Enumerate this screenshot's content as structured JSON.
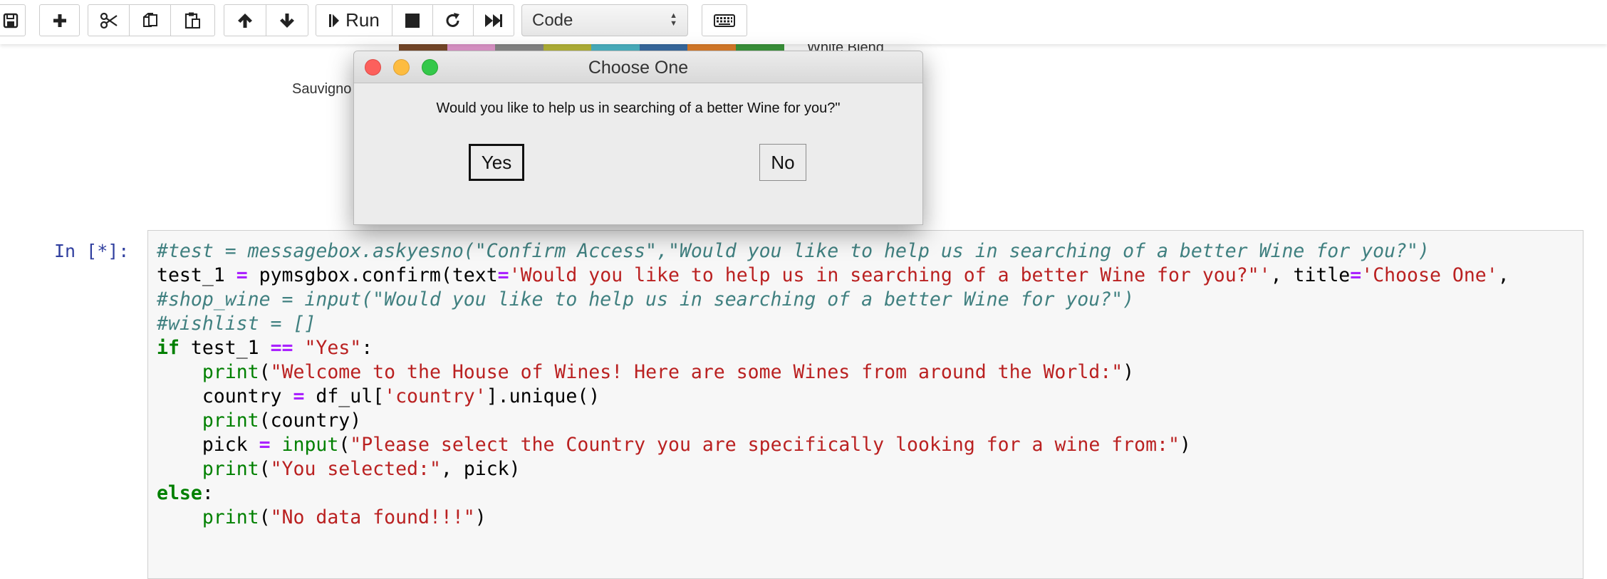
{
  "toolbar": {
    "run_label": "Run",
    "cell_type": "Code",
    "buttons": [
      "save-icon",
      "plus-icon",
      "scissors-icon",
      "copy-icon",
      "paste-icon",
      "arrow-up-icon",
      "arrow-down-icon",
      "step-forward-icon",
      "stop-icon",
      "restart-icon",
      "fast-forward-icon",
      "keyboard-icon"
    ]
  },
  "background_output": {
    "label_right": "White Blend",
    "label_left": "Sauvigno",
    "slice_colors": [
      "#7a4a2a",
      "#e59ad0",
      "#8b8b8b",
      "#b9b93a",
      "#4cb8c8",
      "#3a6ea5",
      "#e07f2a",
      "#3d9a3d"
    ]
  },
  "dialog": {
    "title": "Choose One",
    "message": "Would you like to help us in searching of a better Wine for you?\"",
    "yes_label": "Yes",
    "no_label": "No"
  },
  "cell": {
    "prompt": "In [*]:",
    "lines": [
      [
        {
          "t": "#test = messagebox.askyesno(\"Confirm Access\",\"Would you like to help us in searching of a better Wine for you?\")",
          "c": "cm"
        }
      ],
      [
        {
          "t": "test_1 ",
          "c": ""
        },
        {
          "t": "=",
          "c": "op"
        },
        {
          "t": " pymsgbox.confirm(text",
          "c": ""
        },
        {
          "t": "=",
          "c": "op"
        },
        {
          "t": "'Would you like to help us in searching of a better Wine for you?\"'",
          "c": "st"
        },
        {
          "t": ", title",
          "c": ""
        },
        {
          "t": "=",
          "c": "op"
        },
        {
          "t": "'Choose One'",
          "c": "st"
        },
        {
          "t": ",",
          "c": ""
        }
      ],
      [
        {
          "t": "#shop_wine = input(\"Would you like to help us in searching of a better Wine for you?\")",
          "c": "cm"
        }
      ],
      [
        {
          "t": "#wishlist = []",
          "c": "cm"
        }
      ],
      [
        {
          "t": "if",
          "c": "kw"
        },
        {
          "t": " test_1 ",
          "c": ""
        },
        {
          "t": "==",
          "c": "op"
        },
        {
          "t": " ",
          "c": ""
        },
        {
          "t": "\"Yes\"",
          "c": "st"
        },
        {
          "t": ":",
          "c": ""
        }
      ],
      [
        {
          "t": "    ",
          "c": ""
        },
        {
          "t": "print",
          "c": "bi"
        },
        {
          "t": "(",
          "c": ""
        },
        {
          "t": "\"Welcome to the House of Wines! Here are some Wines from around the World:\"",
          "c": "st"
        },
        {
          "t": ")",
          "c": ""
        }
      ],
      [
        {
          "t": "    country ",
          "c": ""
        },
        {
          "t": "=",
          "c": "op"
        },
        {
          "t": " df_ul[",
          "c": ""
        },
        {
          "t": "'country'",
          "c": "st"
        },
        {
          "t": "].unique()",
          "c": ""
        }
      ],
      [
        {
          "t": "    ",
          "c": ""
        },
        {
          "t": "print",
          "c": "bi"
        },
        {
          "t": "(country)",
          "c": ""
        }
      ],
      [
        {
          "t": "    pick ",
          "c": ""
        },
        {
          "t": "=",
          "c": "op"
        },
        {
          "t": " ",
          "c": ""
        },
        {
          "t": "input",
          "c": "bi"
        },
        {
          "t": "(",
          "c": ""
        },
        {
          "t": "\"Please select the Country you are specifically looking for a wine from:\"",
          "c": "st"
        },
        {
          "t": ")",
          "c": ""
        }
      ],
      [
        {
          "t": "    ",
          "c": ""
        },
        {
          "t": "print",
          "c": "bi"
        },
        {
          "t": "(",
          "c": ""
        },
        {
          "t": "\"You selected:\"",
          "c": "st"
        },
        {
          "t": ", pick)",
          "c": ""
        }
      ],
      [
        {
          "t": "else",
          "c": "kw"
        },
        {
          "t": ":",
          "c": ""
        }
      ],
      [
        {
          "t": "    ",
          "c": ""
        },
        {
          "t": "print",
          "c": "bi"
        },
        {
          "t": "(",
          "c": ""
        },
        {
          "t": "\"No data found!!!\"",
          "c": "st"
        },
        {
          "t": ")",
          "c": ""
        }
      ]
    ]
  }
}
